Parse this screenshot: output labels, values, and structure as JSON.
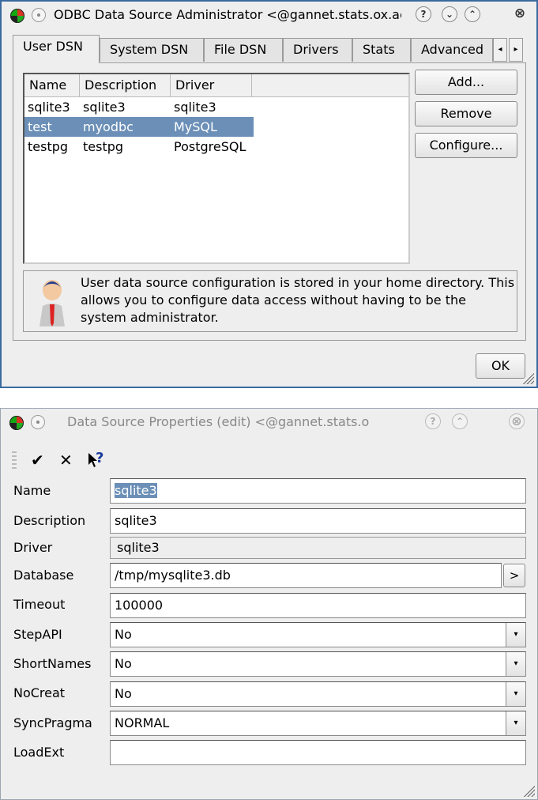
{
  "odbc_window": {
    "title": "ODBC Data Source Administrator <@gannet.stats.ox.ac",
    "titlebar_buttons": [
      "?",
      "⌄",
      "⌃",
      "⊗"
    ],
    "tabs": [
      {
        "label": "User DSN",
        "active": true
      },
      {
        "label": "System DSN",
        "active": false
      },
      {
        "label": "File DSN",
        "active": false
      },
      {
        "label": "Drivers",
        "active": false
      },
      {
        "label": "Stats",
        "active": false
      },
      {
        "label": "Advanced",
        "active": false
      }
    ],
    "tab_scroll": {
      "left": "◂",
      "right": "▸"
    },
    "list": {
      "columns": [
        "Name",
        "Description",
        "Driver"
      ],
      "rows": [
        {
          "name": "sqlite3",
          "description": "sqlite3",
          "driver": "sqlite3",
          "selected": false
        },
        {
          "name": "test",
          "description": "myodbc",
          "driver": "MySQL",
          "selected": true
        },
        {
          "name": "testpg",
          "description": "testpg",
          "driver": "PostgreSQL",
          "selected": false
        }
      ]
    },
    "buttons": {
      "add": "Add...",
      "remove": "Remove",
      "configure": "Configure..."
    },
    "info_text": "User data source configuration is stored in your home directory. This allows you to configure data access without having to be the system administrator.",
    "ok": "OK"
  },
  "props_window": {
    "title": "Data Source Properties (edit) <@gannet.stats.o",
    "titlebar_buttons": [
      "?",
      "⌃",
      "⊗"
    ],
    "toolbar": {
      "save": "✔",
      "cancel": "✕",
      "whats_this": "?"
    },
    "fields": {
      "name": {
        "label": "Name",
        "value": "sqlite3"
      },
      "description": {
        "label": "Description",
        "value": "sqlite3"
      },
      "driver": {
        "label": "Driver",
        "value": "sqlite3"
      },
      "database": {
        "label": "Database",
        "value": "/tmp/mysqlite3.db",
        "browse": ">"
      },
      "timeout": {
        "label": "Timeout",
        "value": "100000"
      },
      "stepapi": {
        "label": "StepAPI",
        "value": "No"
      },
      "shortnames": {
        "label": "ShortNames",
        "value": "No"
      },
      "nocreat": {
        "label": "NoCreat",
        "value": "No"
      },
      "syncpragma": {
        "label": "SyncPragma",
        "value": "NORMAL"
      },
      "loadext": {
        "label": "LoadExt",
        "value": ""
      }
    },
    "combo_arrow": "▾"
  }
}
